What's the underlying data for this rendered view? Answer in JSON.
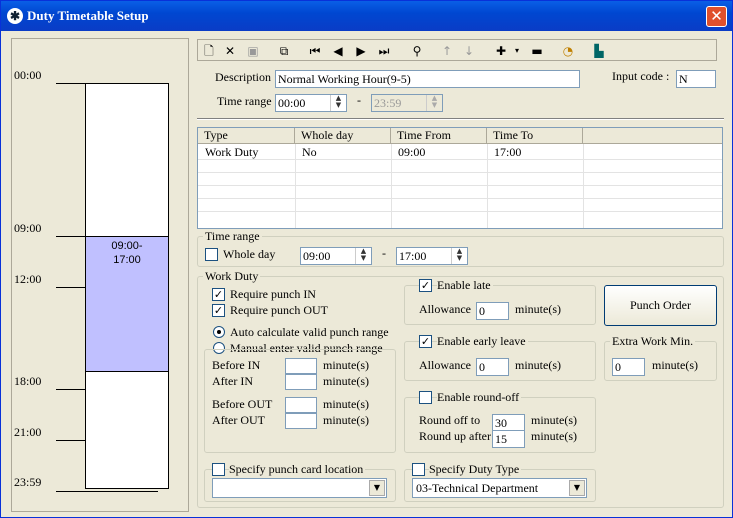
{
  "window": {
    "title": "Duty Timetable Setup",
    "close": "✕"
  },
  "timeline": {
    "labels": [
      "00:00",
      "09:00",
      "12:00",
      "18:00",
      "21:00",
      "23:59"
    ],
    "slot_text": "09:00-\n17:00",
    "slot_color": "#c0c0ff"
  },
  "toolbar": {
    "icons": [
      "new-icon",
      "delete-icon",
      "save-icon",
      "copy-icon",
      "first-icon",
      "prev-icon",
      "next-icon",
      "last-icon",
      "search-icon",
      "up-icon",
      "down-icon",
      "add-icon",
      "remove-icon",
      "clock-icon",
      "exit-icon"
    ]
  },
  "form": {
    "description_label": "Description",
    "description_value": "Normal Working Hour(9-5)",
    "input_code_label": "Input code :",
    "input_code_value": "N",
    "time_range_label": "Time range",
    "time_from": "00:00",
    "time_to": "23:59",
    "dash": "-"
  },
  "grid": {
    "headers": [
      "Type",
      "Whole day",
      "Time From",
      "Time To"
    ],
    "rows": [
      [
        "Work Duty",
        "No",
        "09:00",
        "17:00"
      ]
    ]
  },
  "time_range_group": {
    "title": "Time range",
    "whole_day_label": "Whole day",
    "from": "09:00",
    "to": "17:00",
    "dash": "-"
  },
  "work_duty": {
    "title": "Work Duty",
    "require_in": "Require punch IN",
    "require_out": "Require punch OUT",
    "auto_calc": "Auto calculate valid punch range",
    "manual": "Manual enter valid punch range",
    "before_in": "Before IN",
    "after_in": "After IN",
    "before_out": "Before OUT",
    "after_out": "After OUT",
    "minutes": "minute(s)"
  },
  "late": {
    "label": "Enable late",
    "allowance_label": "Allowance",
    "value": "0",
    "unit": "minute(s)"
  },
  "early": {
    "label": "Enable early leave",
    "allowance_label": "Allowance",
    "value": "0",
    "unit": "minute(s)"
  },
  "roundoff": {
    "label": "Enable round-off",
    "round_off_label": "Round off to",
    "round_off_value": "30",
    "round_up_label": "Round up after",
    "round_up_value": "15",
    "unit": "minute(s)"
  },
  "punch_order": {
    "label": "Punch Order"
  },
  "extra_work": {
    "title": "Extra Work Min.",
    "value": "0",
    "unit": "minute(s)"
  },
  "location": {
    "label": "Specify punch card location",
    "value": ""
  },
  "duty_type": {
    "label": "Specify Duty Type",
    "value": "03-Technical Department"
  }
}
